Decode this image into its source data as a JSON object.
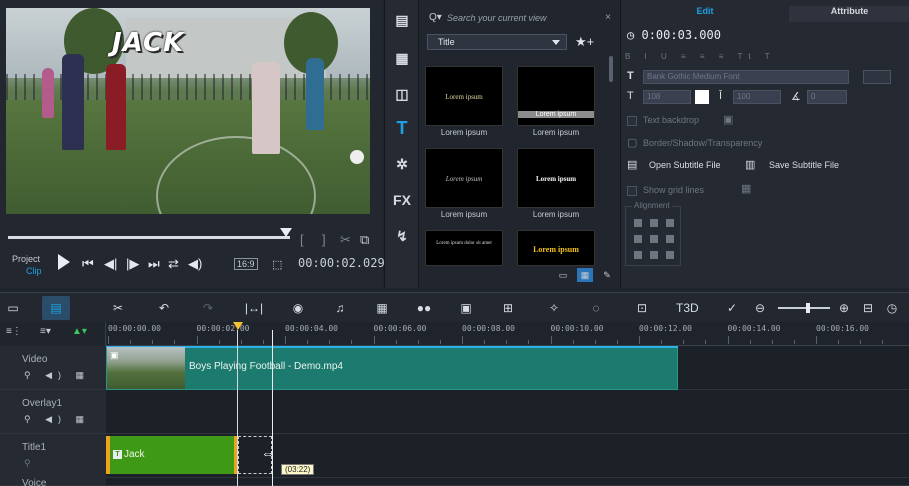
{
  "preview": {
    "overlay_title": "JACK",
    "mode_project": "Project",
    "mode_clip": "Clip",
    "aspect": "16:9",
    "timecode": "00:00:02.029"
  },
  "library": {
    "search_placeholder": "Search your current view",
    "category": "Title",
    "thumbnails": [
      {
        "preview_text": "Lorem ipsum",
        "label": "Lorem ipsum",
        "color": "#e8d9a0"
      },
      {
        "preview_text": "Lorem ipsum",
        "label": "Lorem ipsum",
        "color": "#ffffff"
      },
      {
        "preview_text": "Lorem ipsum",
        "label": "Lorem ipsum",
        "color": "#bfbfbf"
      },
      {
        "preview_text": "Lorem ipsum",
        "label": "Lorem ipsum",
        "color": "#f5f5f5"
      },
      {
        "preview_text": "Lorem ipsum dolor sit amet",
        "label": "",
        "color": "#dddddd"
      },
      {
        "preview_text": "Lorem ipsum",
        "label": "",
        "color": "#f3c21b"
      }
    ]
  },
  "options": {
    "tab_edit": "Edit",
    "tab_attribute": "Attribute",
    "duration": "0:00:03.000",
    "font_name": "Bank Gothic Medium Font",
    "font_size": "108",
    "line_spacing": "100",
    "rotation": "0",
    "text_backdrop": "Text backdrop",
    "border_shadow": "Border/Shadow/Transparency",
    "open_subtitle": "Open Subtitle File",
    "save_subtitle": "Save Subtitle File",
    "show_grid": "Show grid lines",
    "alignment": "Alignment"
  },
  "timeline": {
    "ruler_labels": [
      "00:00:00.00",
      "00:00:02.00",
      "00:00:04.00",
      "00:00:06.00",
      "00:00:08.00",
      "00:00:10.00",
      "00:00:12.00",
      "00:00:14.00",
      "00:00:16.00"
    ],
    "tracks": [
      {
        "name": "Video"
      },
      {
        "name": "Overlay1"
      },
      {
        "name": "Title1"
      },
      {
        "name": "Voice"
      }
    ],
    "video_clip": "Boys Playing Football - Demo.mp4",
    "title_clip": "Jack",
    "drag_tooltip": "(03:22)"
  },
  "colors": {
    "accent": "#1ea2e0",
    "video_clip": "#1d7a6e",
    "title_clip": "#3e9a16",
    "trim_handle": "#f0a21b"
  }
}
